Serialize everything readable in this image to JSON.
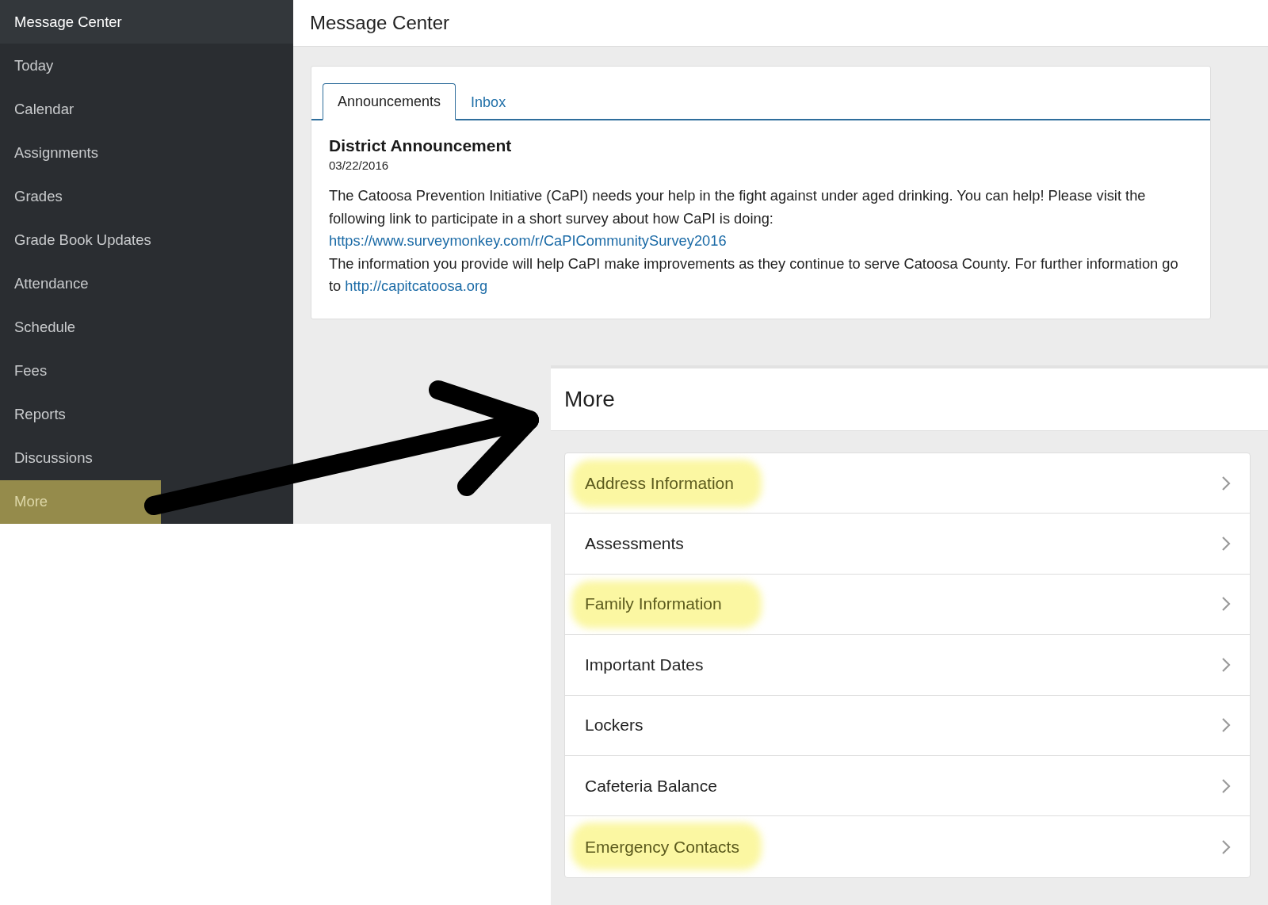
{
  "sidebar": {
    "items": [
      {
        "label": "Message Center",
        "selected": false,
        "kind": "header"
      },
      {
        "label": "Today",
        "selected": false,
        "kind": "item"
      },
      {
        "label": "Calendar",
        "selected": false,
        "kind": "item"
      },
      {
        "label": "Assignments",
        "selected": false,
        "kind": "item"
      },
      {
        "label": "Grades",
        "selected": false,
        "kind": "item"
      },
      {
        "label": "Grade Book Updates",
        "selected": false,
        "kind": "item"
      },
      {
        "label": "Attendance",
        "selected": false,
        "kind": "item"
      },
      {
        "label": "Schedule",
        "selected": false,
        "kind": "item"
      },
      {
        "label": "Fees",
        "selected": false,
        "kind": "item"
      },
      {
        "label": "Reports",
        "selected": false,
        "kind": "item"
      },
      {
        "label": "Discussions",
        "selected": false,
        "kind": "item"
      },
      {
        "label": "More",
        "selected": true,
        "kind": "item"
      }
    ]
  },
  "page_title": "Message Center",
  "tabs": [
    {
      "label": "Announcements",
      "selected": true
    },
    {
      "label": "Inbox",
      "selected": false
    }
  ],
  "announcement": {
    "title": "District Announcement",
    "date": "03/22/2016",
    "lines": [
      {
        "text": "The Catoosa Prevention Initiative (CaPI) needs your help in the fight against under aged drinking. You can help! Please visit the following link to participate in a short survey about how CaPI is doing:"
      },
      {
        "link": "https://www.surveymonkey.com/r/CaPICommunitySurvey2016"
      },
      {
        "text": "The information you provide will help CaPI make improvements as they continue to serve Catoosa County. For further information go to",
        "link": "http://capitcatoosa.org"
      }
    ]
  },
  "more_panel": {
    "title": "More",
    "items": [
      {
        "label": "Address Information",
        "highlighted": true
      },
      {
        "label": "Assessments",
        "highlighted": false
      },
      {
        "label": "Family Information",
        "highlighted": true
      },
      {
        "label": "Important Dates",
        "highlighted": false
      },
      {
        "label": "Lockers",
        "highlighted": false
      },
      {
        "label": "Cafeteria Balance",
        "highlighted": false
      },
      {
        "label": "Emergency Contacts",
        "highlighted": true
      }
    ]
  }
}
